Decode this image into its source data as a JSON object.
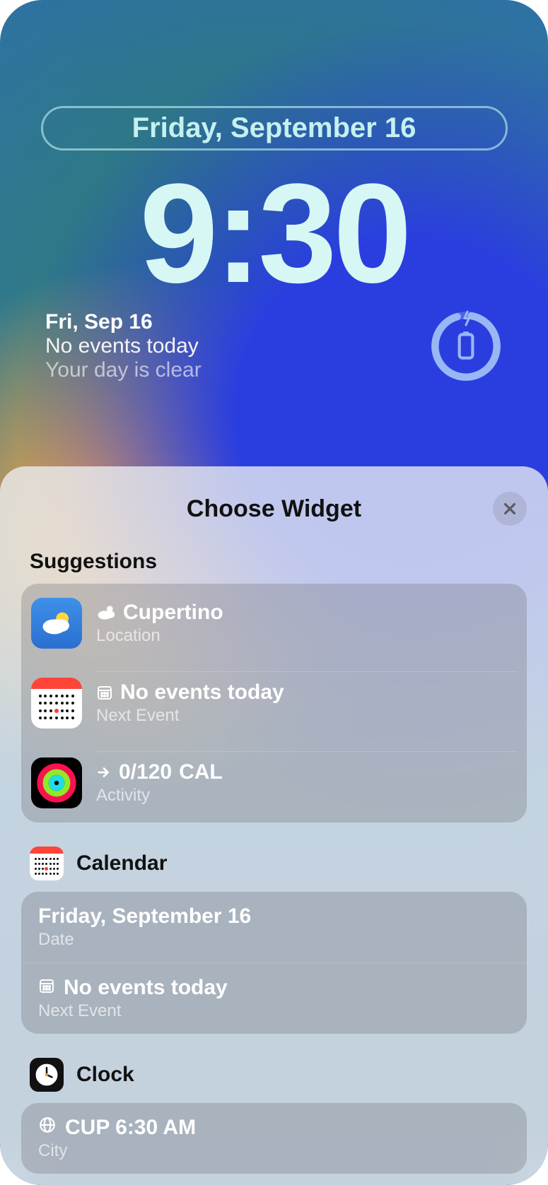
{
  "lockscreen": {
    "date_full": "Friday, September 16",
    "time": "9:30",
    "calendar_widget": {
      "date_short": "Fri, Sep 16",
      "events_line": "No events today",
      "clear_line": "Your day is clear"
    }
  },
  "sheet": {
    "title": "Choose Widget",
    "suggestions_label": "Suggestions",
    "suggestions": [
      {
        "title": "Cupertino",
        "subtitle": "Location",
        "icon": "weather"
      },
      {
        "title": "No events today",
        "subtitle": "Next Event",
        "icon": "calendar"
      },
      {
        "title": "0/120",
        "unit": "CAL",
        "subtitle": "Activity",
        "icon": "activity"
      }
    ],
    "sections": [
      {
        "app": "Calendar",
        "icon": "calendar",
        "rows": [
          {
            "title": "Friday, September 16",
            "subtitle": "Date"
          },
          {
            "title": "No events today",
            "subtitle": "Next Event",
            "glyph": "calendar-grid"
          }
        ]
      },
      {
        "app": "Clock",
        "icon": "clock",
        "rows": [
          {
            "title": "CUP 6:30 AM",
            "subtitle": "City",
            "glyph": "globe"
          }
        ]
      }
    ]
  }
}
